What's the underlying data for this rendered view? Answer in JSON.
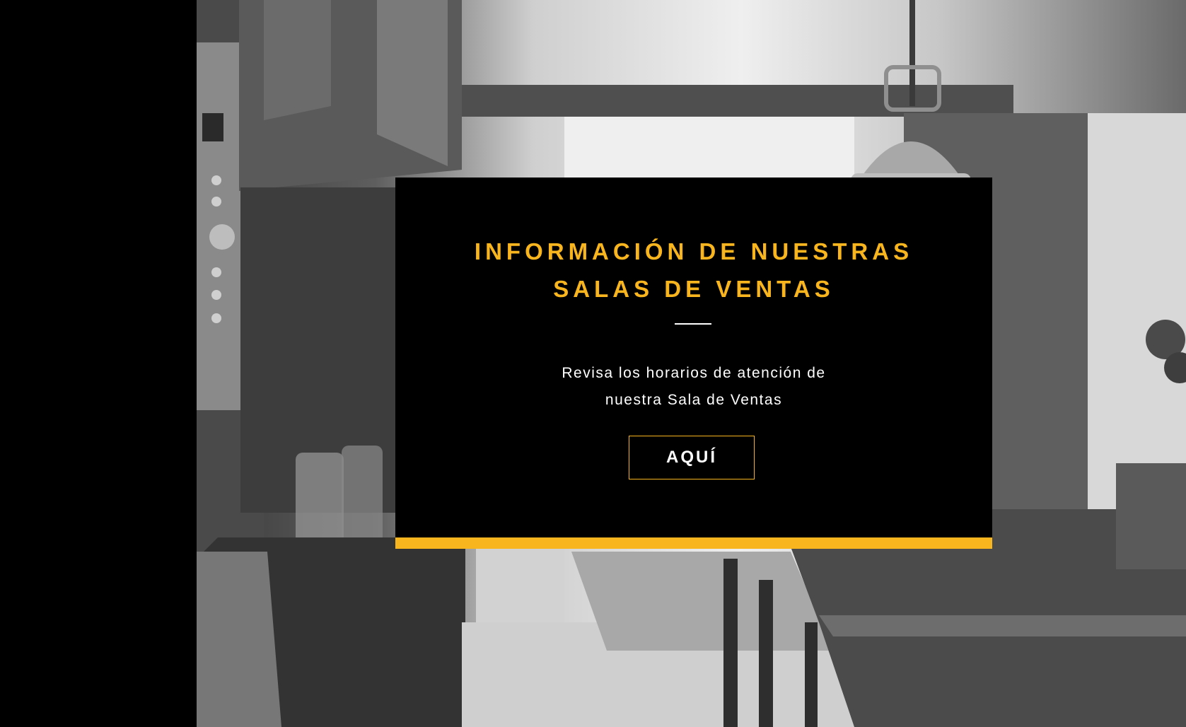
{
  "banner": {
    "title_line_1": "INFORMACIÓN DE NUESTRAS",
    "title_line_2": "SALAS DE VENTAS",
    "description_line_1": "Revisa los horarios de atención de",
    "description_line_2": "nuestra Sala de Ventas",
    "cta_label": "AQUÍ"
  },
  "background": {
    "image_subject_icon": "kitchen-photo"
  },
  "colors": {
    "accent": "#f9b51d",
    "card_background": "#000000",
    "text": "#ffffff",
    "page_background": "#000000"
  }
}
